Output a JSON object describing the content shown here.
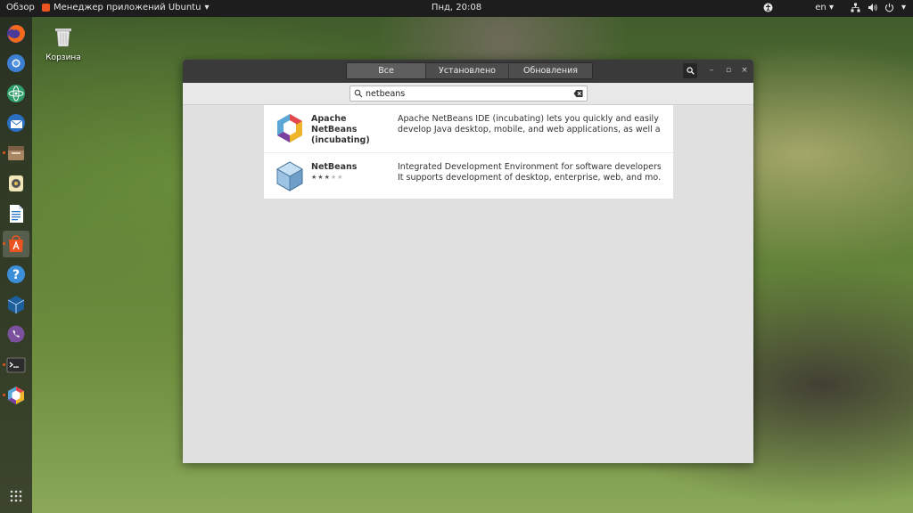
{
  "topbar": {
    "activities": "Обзор",
    "app_menu": "Менеджер приложений Ubuntu",
    "clock": "Пнд, 20:08",
    "language": "en",
    "menu_arrow": "▾"
  },
  "desktop": {
    "trash_label": "Корзина"
  },
  "dock": {
    "items": [
      {
        "name": "firefox-icon"
      },
      {
        "name": "chromium-icon"
      },
      {
        "name": "atom-icon"
      },
      {
        "name": "thunderbird-icon"
      },
      {
        "name": "files-icon"
      },
      {
        "name": "rhythmbox-icon"
      },
      {
        "name": "writer-icon"
      },
      {
        "name": "software-center-icon"
      },
      {
        "name": "help-icon"
      },
      {
        "name": "virtualbox-icon"
      },
      {
        "name": "viber-icon"
      },
      {
        "name": "terminal-icon"
      },
      {
        "name": "netbeans-icon"
      }
    ],
    "accent": "#e95420"
  },
  "window": {
    "tabs": [
      {
        "label": "Все",
        "active": true
      },
      {
        "label": "Установлено",
        "active": false
      },
      {
        "label": "Обновления",
        "active": false
      }
    ],
    "controls": {
      "minimize": "–",
      "maximize": "▫",
      "close": "×"
    },
    "search": {
      "value": "netbeans"
    },
    "results": [
      {
        "name_lines": [
          "Apache",
          "NetBeans",
          "(incubating)"
        ],
        "desc_lines": [
          "Apache NetBeans IDE (incubating) lets you quickly and easily",
          "develop Java desktop, mobile, and web applications, as well a…"
        ],
        "rating": null
      },
      {
        "name_lines": [
          "NetBeans"
        ],
        "desc_lines": [
          "Integrated Development Environment for software developers.",
          "It supports development of desktop, enterprise, web, and mo…"
        ],
        "rating": 3
      }
    ]
  }
}
